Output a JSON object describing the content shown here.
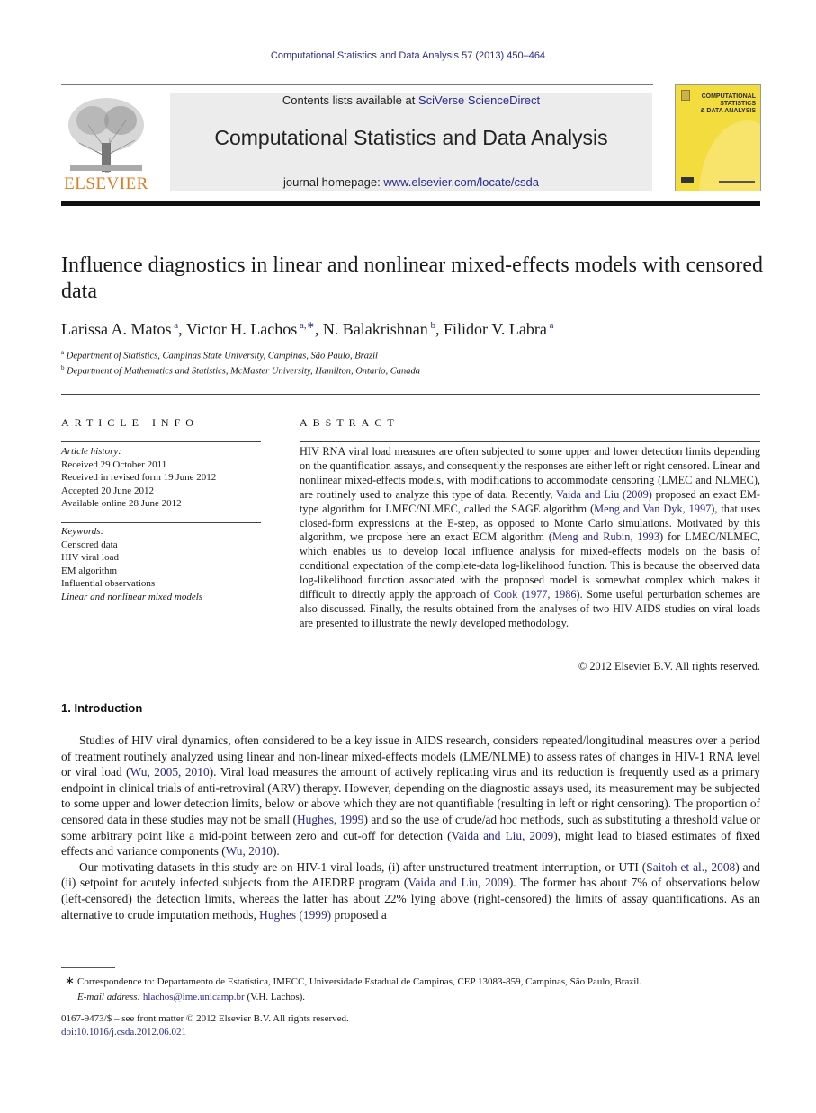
{
  "journal_reference": "Computational Statistics and Data Analysis 57 (2013) 450–464",
  "header": {
    "publisher": "ELSEVIER",
    "contents_prefix": "Contents lists available at ",
    "contents_link": "SciVerse ScienceDirect",
    "journal_title": "Computational Statistics and Data Analysis",
    "homepage_prefix": "journal homepage: ",
    "homepage_link": "www.elsevier.com/locate/csda",
    "cover_title_lines": [
      "COMPUTATIONAL",
      "STATISTICS",
      "& DATA ANALYSIS"
    ],
    "colors": {
      "publisher_orange": "#e07a1c",
      "link_blue": "#2a2a8c",
      "cover_yellow": "#f3dc3e"
    }
  },
  "article": {
    "title": "Influence diagnostics in linear and nonlinear mixed-effects models with censored data",
    "authors": [
      {
        "name": "Larissa A. Matos",
        "sup": "a"
      },
      {
        "name": "Victor H. Lachos",
        "sup": "a,∗"
      },
      {
        "name": "N. Balakrishnan",
        "sup": "b"
      },
      {
        "name": "Filidor V. Labra",
        "sup": "a"
      }
    ],
    "affiliations": [
      {
        "sup": "a",
        "text": "Department of Statistics, Campinas State University, Campinas, São Paulo, Brazil"
      },
      {
        "sup": "b",
        "text": "Department of Mathematics and Statistics, McMaster University, Hamilton, Ontario, Canada"
      }
    ]
  },
  "article_info": {
    "heading": "ARTICLE INFO",
    "history_label": "Article history:",
    "history": [
      "Received 29 October 2011",
      "Received in revised form 19 June 2012",
      "Accepted 20 June 2012",
      "Available online 28 June 2012"
    ],
    "keywords_label": "Keywords:",
    "keywords": [
      "Censored data",
      "HIV viral load",
      "EM algorithm",
      "Influential observations",
      "Linear and nonlinear mixed models"
    ]
  },
  "abstract": {
    "heading": "ABSTRACT",
    "parts": [
      "HIV RNA viral load measures are often subjected to some upper and lower detection limits depending on the quantification assays, and consequently the responses are either left or right censored. Linear and nonlinear mixed-effects models, with modifications to accommodate censoring (LMEC and NLMEC), are routinely used to analyze this type of data. Recently, ",
      "Vaida and Liu (2009)",
      " proposed an exact EM-type algorithm for LMEC/NLMEC, called the SAGE algorithm (",
      "Meng and Van Dyk, 1997",
      "), that uses closed-form expressions at the E-step, as opposed to Monte Carlo simulations. Motivated by this algorithm, we propose here an exact ECM algorithm (",
      "Meng and Rubin, 1993",
      ") for LMEC/NLMEC, which enables us to develop local influence analysis for mixed-effects models on the basis of conditional expectation of the complete-data log-likelihood function. This is because the observed data log-likelihood function associated with the proposed model is somewhat complex which makes it difficult to directly apply the approach of ",
      "Cook (1977, 1986)",
      ". Some useful perturbation schemes are also discussed. Finally, the results obtained from the analyses of two HIV AIDS studies on viral loads are presented to illustrate the newly developed methodology."
    ],
    "copyright": "© 2012 Elsevier B.V. All rights reserved."
  },
  "introduction": {
    "heading": "1.  Introduction",
    "p1": [
      "Studies of HIV viral dynamics, often considered to be a key issue in AIDS research, considers repeated/longitudinal measures over a period of treatment routinely analyzed using linear and non-linear mixed-effects models (LME/NLME) to assess rates of changes in HIV-1 RNA level or viral load (",
      "Wu, 2005, 2010",
      "). Viral load measures the amount of actively replicating virus and its reduction is frequently used as a primary endpoint in clinical trials of anti-retroviral (ARV) therapy. However, depending on the diagnostic assays used, its measurement may be subjected to some upper and lower detection limits, below or above which they are not quantifiable (resulting in left or right censoring). The proportion of censored data in these studies may not be small (",
      "Hughes, 1999",
      ") and so the use of crude/ad hoc methods, such as substituting a threshold value or some arbitrary point like a mid-point between zero and cut-off for detection (",
      "Vaida and Liu, 2009",
      "), might lead to biased estimates of fixed effects and variance components (",
      "Wu, 2010",
      ")."
    ],
    "p2": [
      "Our motivating datasets in this study are on HIV-1 viral loads, (i) after unstructured treatment interruption, or UTI (",
      "Saitoh et al., 2008",
      ") and (ii) setpoint for acutely infected subjects from the AIEDRP program (",
      "Vaida and Liu, 2009",
      "). The former has about 7% of observations below (left-censored) the detection limits, whereas the latter has about 22% lying above (right-censored) the limits of assay quantifications. As an alternative to crude imputation methods, ",
      "Hughes (1999)",
      " proposed a"
    ]
  },
  "footnote": {
    "star": "∗",
    "correspondence": "Correspondence to: Departamento de Estatística, IMECC, Universidade Estadual de Campinas, CEP 13083-859, Campinas, São Paulo, Brazil.",
    "email_label": "E-mail address: ",
    "email": "hlachos@ime.unicamp.br",
    "email_suffix": " (V.H. Lachos)."
  },
  "front_matter": {
    "issn_line": "0167-9473/$ – see front matter © 2012 Elsevier B.V. All rights reserved.",
    "doi": "doi:10.1016/j.csda.2012.06.021"
  }
}
